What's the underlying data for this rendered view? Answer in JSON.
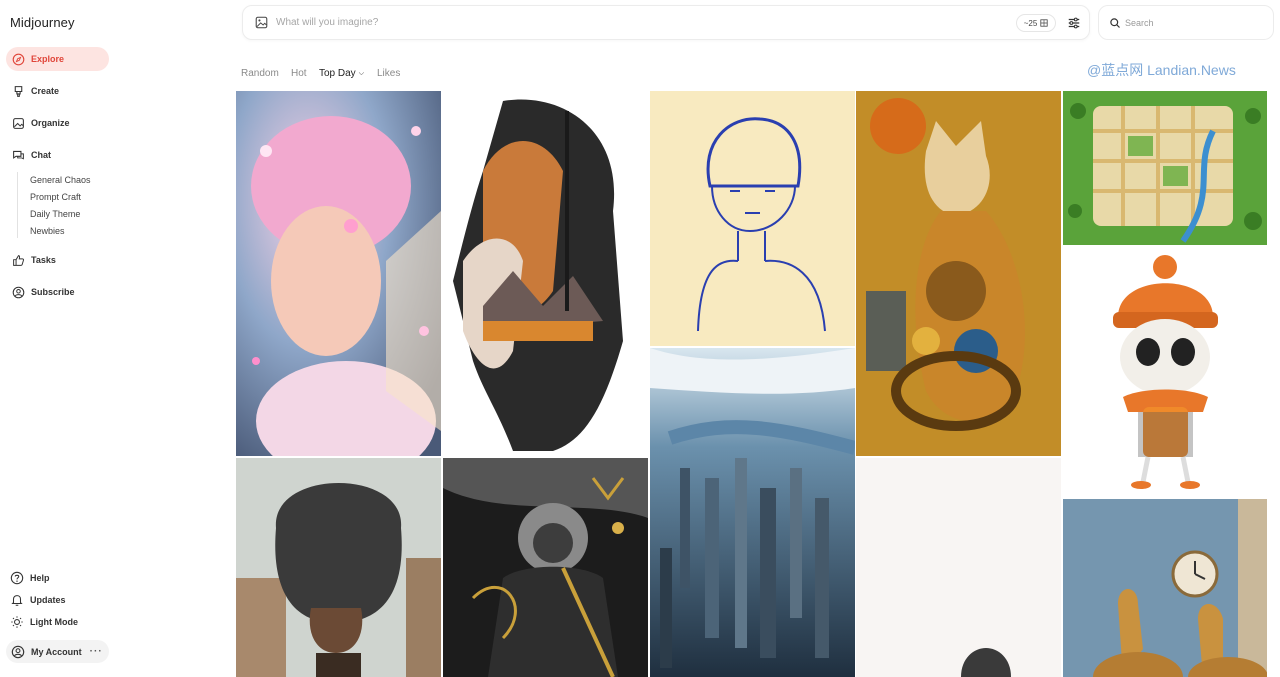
{
  "app": {
    "title": "Midjourney"
  },
  "sidebar": {
    "items": [
      {
        "label": "Explore",
        "icon": "compass-icon"
      },
      {
        "label": "Create",
        "icon": "brush-icon"
      },
      {
        "label": "Organize",
        "icon": "image-icon"
      },
      {
        "label": "Chat",
        "icon": "chat-icon"
      },
      {
        "label": "Tasks",
        "icon": "thumbs-up-icon"
      },
      {
        "label": "Subscribe",
        "icon": "user-circle-icon"
      }
    ],
    "chat_channels": [
      "General Chaos",
      "Prompt Craft",
      "Daily Theme",
      "Newbies"
    ],
    "footer": [
      {
        "label": "Help",
        "icon": "question-icon"
      },
      {
        "label": "Updates",
        "icon": "bell-icon"
      },
      {
        "label": "Light Mode",
        "icon": "sun-icon"
      }
    ],
    "account": {
      "label": "My Account",
      "more": "···"
    }
  },
  "prompt_bar": {
    "placeholder": "What will you imagine?",
    "aspect_ratio": "~25"
  },
  "search": {
    "placeholder": "Search"
  },
  "tabs": [
    {
      "label": "Random"
    },
    {
      "label": "Hot"
    },
    {
      "label": "Top Day",
      "active": true
    },
    {
      "label": "Likes"
    }
  ],
  "watermark": "@蓝点网 Landian.News",
  "colors": {
    "accent": "#e0463a",
    "accent_bg": "#fde4e1"
  },
  "gallery": [
    {
      "subject": "pink-haired-fairy-portrait"
    },
    {
      "subject": "double-exposure-profile-forest"
    },
    {
      "subject": "blue-line-sketch-girl"
    },
    {
      "subject": "golden-mosaic-cat"
    },
    {
      "subject": "top-down-city-map"
    },
    {
      "subject": "skeleton-in-orange-beanie"
    },
    {
      "subject": "man-with-tall-fur-hat"
    },
    {
      "subject": "ink-and-gold-monkey-warrior"
    },
    {
      "subject": "aerial-skyscraper-city"
    },
    {
      "subject": "minimal-figure-on-light-background"
    },
    {
      "subject": "rabbits-in-blue-room-with-clock"
    }
  ]
}
